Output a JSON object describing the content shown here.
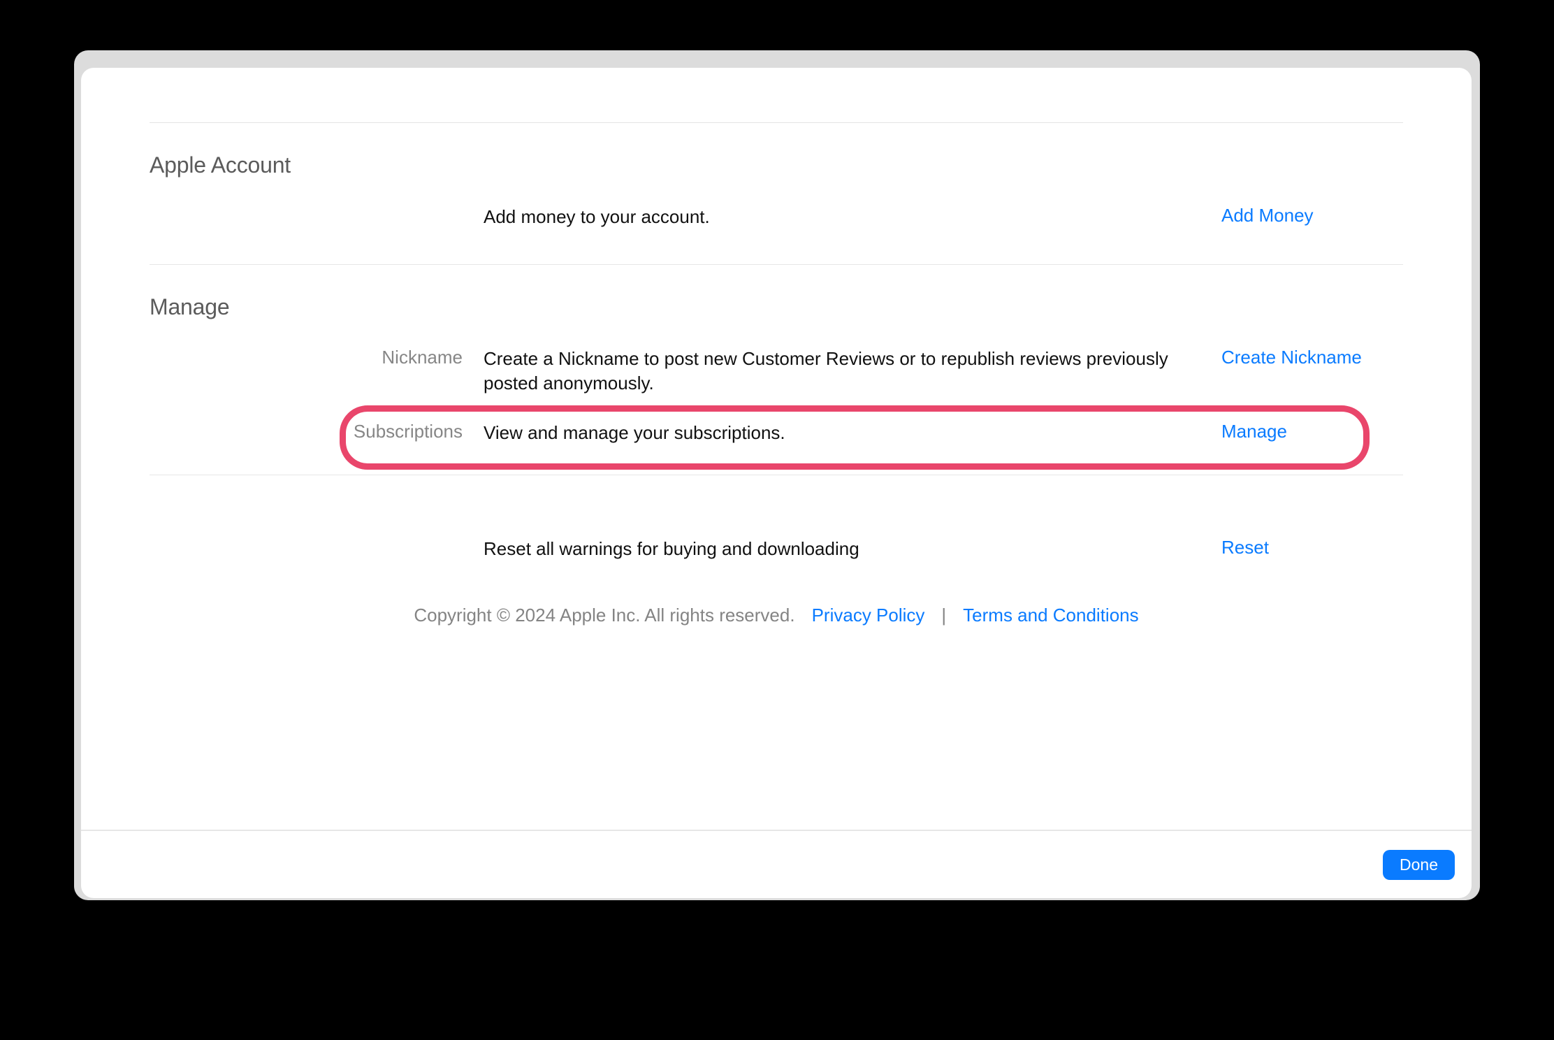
{
  "sections": {
    "apple_account": {
      "title": "Apple Account",
      "add_money": {
        "label": "",
        "desc": "Add money to your account.",
        "action": "Add Money"
      }
    },
    "manage": {
      "title": "Manage",
      "nickname": {
        "label": "Nickname",
        "desc": "Create a Nickname to post new Customer Reviews or to republish reviews previously posted anonymously.",
        "action": "Create Nickname"
      },
      "subscriptions": {
        "label": "Subscriptions",
        "desc": "View and manage your subscriptions.",
        "action": "Manage"
      }
    },
    "reset": {
      "label": "",
      "desc": "Reset all warnings for buying and downloading",
      "action": "Reset"
    }
  },
  "footer": {
    "copyright": "Copyright © 2024 Apple Inc. All rights reserved.",
    "privacy": "Privacy Policy",
    "divider": "|",
    "terms": "Terms and Conditions"
  },
  "bottom": {
    "done": "Done"
  }
}
